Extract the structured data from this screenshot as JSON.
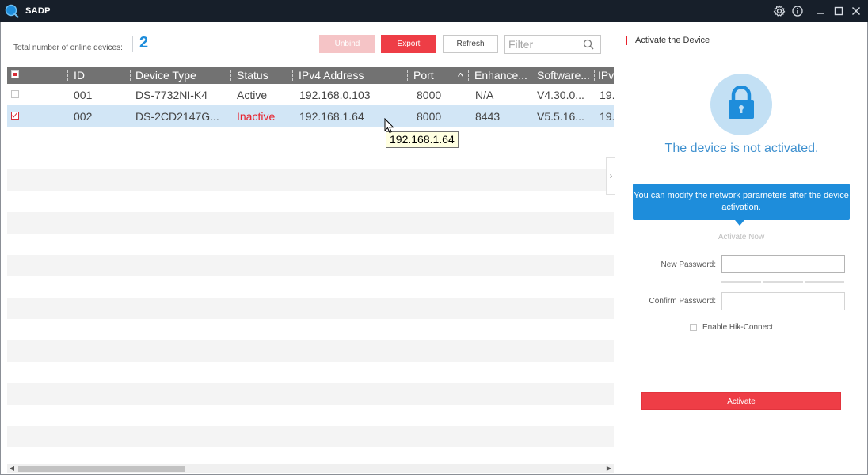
{
  "window": {
    "title": "SADP"
  },
  "toolbar": {
    "total_label": "Total number of online devices:",
    "total_count": "2",
    "unbind": "Unbind",
    "export": "Export",
    "refresh": "Refresh",
    "filter_placeholder": "Filter"
  },
  "table": {
    "columns": [
      "ID",
      "Device Type",
      "Status",
      "IPv4 Address",
      "Port",
      "Enhance...",
      "Software...",
      "IPv"
    ],
    "rows": [
      {
        "id": "001",
        "device_type": "DS-7732NI-K4",
        "status": "Active",
        "ipv4": "192.168.0.103",
        "port": "8000",
        "enhanced": "N/A",
        "software": "V4.30.0...",
        "ipv": "19.",
        "checked": false
      },
      {
        "id": "002",
        "device_type": "DS-2CD2147G...",
        "status": "Inactive",
        "ipv4": "192.168.1.64",
        "port": "8000",
        "enhanced": "8443",
        "software": "V5.5.16...",
        "ipv": "19.",
        "checked": true
      }
    ],
    "tooltip": "192.168.1.64",
    "sort_indicator": "^"
  },
  "panel": {
    "title": "Activate the Device",
    "not_activated": "The device is not activated.",
    "info": "You can modify the network parameters after the device activation.",
    "activate_now": "Activate Now",
    "new_password_label": "New Password:",
    "confirm_password_label": "Confirm Password:",
    "hik_connect_label": "Enable Hik-Connect",
    "activate_button": "Activate"
  },
  "colors": {
    "accent_blue": "#1e8ddb",
    "accent_red": "#ee3d46",
    "titlebar": "#171f2a"
  }
}
